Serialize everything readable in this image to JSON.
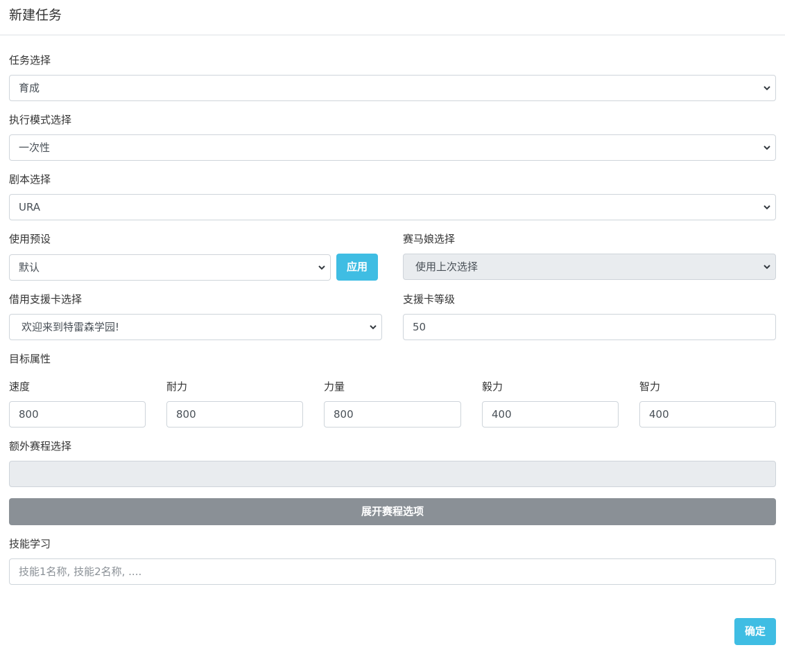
{
  "header": {
    "title": "新建任务"
  },
  "task": {
    "label": "任务选择",
    "value": "育成"
  },
  "mode": {
    "label": "执行模式选择",
    "value": "一次性"
  },
  "scenario": {
    "label": "剧本选择",
    "value": "URA"
  },
  "preset": {
    "label": "使用预设",
    "value": "默认",
    "apply_label": "应用"
  },
  "umamusume": {
    "label": "赛马娘选择",
    "value": "使用上次选择"
  },
  "support_card": {
    "label": "借用支援卡选择",
    "value": "欢迎来到特雷森学园!"
  },
  "support_level": {
    "label": "支援卡等级",
    "value": "50"
  },
  "target_attributes": {
    "label": "目标属性",
    "items": [
      {
        "label": "速度",
        "value": "800"
      },
      {
        "label": "耐力",
        "value": "800"
      },
      {
        "label": "力量",
        "value": "800"
      },
      {
        "label": "毅力",
        "value": "400"
      },
      {
        "label": "智力",
        "value": "400"
      }
    ]
  },
  "extra_race": {
    "label": "额外赛程选择",
    "value": "",
    "expand_label": "展开赛程选项"
  },
  "skills": {
    "label": "技能学习",
    "placeholder": "技能1名称, 技能2名称, ...."
  },
  "footer": {
    "confirm_label": "确定"
  }
}
